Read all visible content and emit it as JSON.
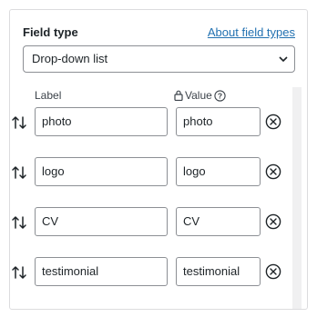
{
  "field_type": {
    "title": "Field type",
    "about_link": "About field types",
    "selected": "Drop-down list"
  },
  "columns": {
    "label": "Label",
    "value": "Value"
  },
  "rows": [
    {
      "label": "photo",
      "value": "photo"
    },
    {
      "label": "logo",
      "value": "logo"
    },
    {
      "label": "CV",
      "value": "CV"
    },
    {
      "label": "testimonial",
      "value": "testimonial"
    }
  ],
  "icons": {
    "drag": "sort-arrows-icon",
    "remove": "circle-x-icon",
    "lock": "lock-icon",
    "help": "question-circle-icon",
    "dropdown": "chevron-down-icon"
  }
}
